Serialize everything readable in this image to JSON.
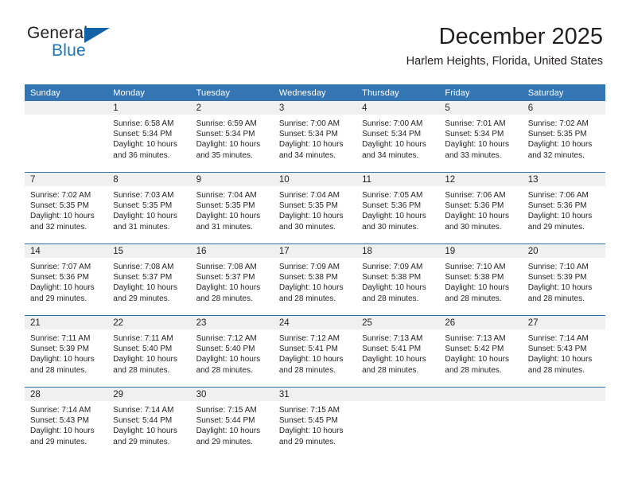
{
  "brand": {
    "word1": "General",
    "word2": "Blue",
    "triangle_color": "#1362a8",
    "blue_color": "#1b75bb"
  },
  "header": {
    "title": "December 2025",
    "subtitle": "Harlem Heights, Florida, United States"
  },
  "theme": {
    "header_bg": "#3475b4",
    "day_band_bg": "#f0f0f0",
    "week_rule": "#2e6da4",
    "text": "#231f20"
  },
  "weekday_headers": [
    "Sunday",
    "Monday",
    "Tuesday",
    "Wednesday",
    "Thursday",
    "Friday",
    "Saturday"
  ],
  "labels": {
    "sunrise_prefix": "Sunrise: ",
    "sunset_prefix": "Sunset: ",
    "daylight_prefix": "Daylight: "
  },
  "weeks": [
    [
      {
        "day": "",
        "sunrise": "",
        "sunset": "",
        "daylight_line1": "",
        "daylight_line2": ""
      },
      {
        "day": "1",
        "sunrise": "Sunrise: 6:58 AM",
        "sunset": "Sunset: 5:34 PM",
        "daylight_line1": "Daylight: 10 hours",
        "daylight_line2": "and 36 minutes."
      },
      {
        "day": "2",
        "sunrise": "Sunrise: 6:59 AM",
        "sunset": "Sunset: 5:34 PM",
        "daylight_line1": "Daylight: 10 hours",
        "daylight_line2": "and 35 minutes."
      },
      {
        "day": "3",
        "sunrise": "Sunrise: 7:00 AM",
        "sunset": "Sunset: 5:34 PM",
        "daylight_line1": "Daylight: 10 hours",
        "daylight_line2": "and 34 minutes."
      },
      {
        "day": "4",
        "sunrise": "Sunrise: 7:00 AM",
        "sunset": "Sunset: 5:34 PM",
        "daylight_line1": "Daylight: 10 hours",
        "daylight_line2": "and 34 minutes."
      },
      {
        "day": "5",
        "sunrise": "Sunrise: 7:01 AM",
        "sunset": "Sunset: 5:34 PM",
        "daylight_line1": "Daylight: 10 hours",
        "daylight_line2": "and 33 minutes."
      },
      {
        "day": "6",
        "sunrise": "Sunrise: 7:02 AM",
        "sunset": "Sunset: 5:35 PM",
        "daylight_line1": "Daylight: 10 hours",
        "daylight_line2": "and 32 minutes."
      }
    ],
    [
      {
        "day": "7",
        "sunrise": "Sunrise: 7:02 AM",
        "sunset": "Sunset: 5:35 PM",
        "daylight_line1": "Daylight: 10 hours",
        "daylight_line2": "and 32 minutes."
      },
      {
        "day": "8",
        "sunrise": "Sunrise: 7:03 AM",
        "sunset": "Sunset: 5:35 PM",
        "daylight_line1": "Daylight: 10 hours",
        "daylight_line2": "and 31 minutes."
      },
      {
        "day": "9",
        "sunrise": "Sunrise: 7:04 AM",
        "sunset": "Sunset: 5:35 PM",
        "daylight_line1": "Daylight: 10 hours",
        "daylight_line2": "and 31 minutes."
      },
      {
        "day": "10",
        "sunrise": "Sunrise: 7:04 AM",
        "sunset": "Sunset: 5:35 PM",
        "daylight_line1": "Daylight: 10 hours",
        "daylight_line2": "and 30 minutes."
      },
      {
        "day": "11",
        "sunrise": "Sunrise: 7:05 AM",
        "sunset": "Sunset: 5:36 PM",
        "daylight_line1": "Daylight: 10 hours",
        "daylight_line2": "and 30 minutes."
      },
      {
        "day": "12",
        "sunrise": "Sunrise: 7:06 AM",
        "sunset": "Sunset: 5:36 PM",
        "daylight_line1": "Daylight: 10 hours",
        "daylight_line2": "and 30 minutes."
      },
      {
        "day": "13",
        "sunrise": "Sunrise: 7:06 AM",
        "sunset": "Sunset: 5:36 PM",
        "daylight_line1": "Daylight: 10 hours",
        "daylight_line2": "and 29 minutes."
      }
    ],
    [
      {
        "day": "14",
        "sunrise": "Sunrise: 7:07 AM",
        "sunset": "Sunset: 5:36 PM",
        "daylight_line1": "Daylight: 10 hours",
        "daylight_line2": "and 29 minutes."
      },
      {
        "day": "15",
        "sunrise": "Sunrise: 7:08 AM",
        "sunset": "Sunset: 5:37 PM",
        "daylight_line1": "Daylight: 10 hours",
        "daylight_line2": "and 29 minutes."
      },
      {
        "day": "16",
        "sunrise": "Sunrise: 7:08 AM",
        "sunset": "Sunset: 5:37 PM",
        "daylight_line1": "Daylight: 10 hours",
        "daylight_line2": "and 28 minutes."
      },
      {
        "day": "17",
        "sunrise": "Sunrise: 7:09 AM",
        "sunset": "Sunset: 5:38 PM",
        "daylight_line1": "Daylight: 10 hours",
        "daylight_line2": "and 28 minutes."
      },
      {
        "day": "18",
        "sunrise": "Sunrise: 7:09 AM",
        "sunset": "Sunset: 5:38 PM",
        "daylight_line1": "Daylight: 10 hours",
        "daylight_line2": "and 28 minutes."
      },
      {
        "day": "19",
        "sunrise": "Sunrise: 7:10 AM",
        "sunset": "Sunset: 5:38 PM",
        "daylight_line1": "Daylight: 10 hours",
        "daylight_line2": "and 28 minutes."
      },
      {
        "day": "20",
        "sunrise": "Sunrise: 7:10 AM",
        "sunset": "Sunset: 5:39 PM",
        "daylight_line1": "Daylight: 10 hours",
        "daylight_line2": "and 28 minutes."
      }
    ],
    [
      {
        "day": "21",
        "sunrise": "Sunrise: 7:11 AM",
        "sunset": "Sunset: 5:39 PM",
        "daylight_line1": "Daylight: 10 hours",
        "daylight_line2": "and 28 minutes."
      },
      {
        "day": "22",
        "sunrise": "Sunrise: 7:11 AM",
        "sunset": "Sunset: 5:40 PM",
        "daylight_line1": "Daylight: 10 hours",
        "daylight_line2": "and 28 minutes."
      },
      {
        "day": "23",
        "sunrise": "Sunrise: 7:12 AM",
        "sunset": "Sunset: 5:40 PM",
        "daylight_line1": "Daylight: 10 hours",
        "daylight_line2": "and 28 minutes."
      },
      {
        "day": "24",
        "sunrise": "Sunrise: 7:12 AM",
        "sunset": "Sunset: 5:41 PM",
        "daylight_line1": "Daylight: 10 hours",
        "daylight_line2": "and 28 minutes."
      },
      {
        "day": "25",
        "sunrise": "Sunrise: 7:13 AM",
        "sunset": "Sunset: 5:41 PM",
        "daylight_line1": "Daylight: 10 hours",
        "daylight_line2": "and 28 minutes."
      },
      {
        "day": "26",
        "sunrise": "Sunrise: 7:13 AM",
        "sunset": "Sunset: 5:42 PM",
        "daylight_line1": "Daylight: 10 hours",
        "daylight_line2": "and 28 minutes."
      },
      {
        "day": "27",
        "sunrise": "Sunrise: 7:14 AM",
        "sunset": "Sunset: 5:43 PM",
        "daylight_line1": "Daylight: 10 hours",
        "daylight_line2": "and 28 minutes."
      }
    ],
    [
      {
        "day": "28",
        "sunrise": "Sunrise: 7:14 AM",
        "sunset": "Sunset: 5:43 PM",
        "daylight_line1": "Daylight: 10 hours",
        "daylight_line2": "and 29 minutes."
      },
      {
        "day": "29",
        "sunrise": "Sunrise: 7:14 AM",
        "sunset": "Sunset: 5:44 PM",
        "daylight_line1": "Daylight: 10 hours",
        "daylight_line2": "and 29 minutes."
      },
      {
        "day": "30",
        "sunrise": "Sunrise: 7:15 AM",
        "sunset": "Sunset: 5:44 PM",
        "daylight_line1": "Daylight: 10 hours",
        "daylight_line2": "and 29 minutes."
      },
      {
        "day": "31",
        "sunrise": "Sunrise: 7:15 AM",
        "sunset": "Sunset: 5:45 PM",
        "daylight_line1": "Daylight: 10 hours",
        "daylight_line2": "and 29 minutes."
      },
      {
        "day": "",
        "sunrise": "",
        "sunset": "",
        "daylight_line1": "",
        "daylight_line2": ""
      },
      {
        "day": "",
        "sunrise": "",
        "sunset": "",
        "daylight_line1": "",
        "daylight_line2": ""
      },
      {
        "day": "",
        "sunrise": "",
        "sunset": "",
        "daylight_line1": "",
        "daylight_line2": ""
      }
    ]
  ]
}
